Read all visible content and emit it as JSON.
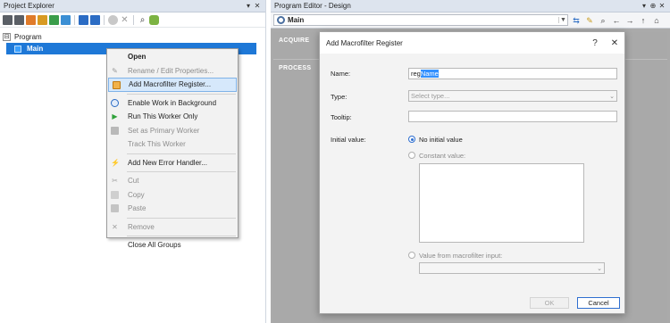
{
  "project_explorer": {
    "title": "Project Explorer",
    "pin": "▾",
    "close": "✕",
    "tree": {
      "root": {
        "expander": "⊟",
        "label": "Program"
      },
      "selected": {
        "label": "Main"
      }
    }
  },
  "context_menu": {
    "items": [
      {
        "label": "Open",
        "bold": true,
        "disabled": false,
        "icon": ""
      },
      {
        "label": "Rename / Edit Properties...",
        "disabled": true,
        "icon": "pencil-icon"
      },
      {
        "label": "Add Macrofilter Register...",
        "disabled": false,
        "icon": "register-icon",
        "hover": true
      },
      {
        "label": "Enable Work in Background",
        "disabled": false,
        "icon": "background-worker-icon"
      },
      {
        "label": "Run This Worker Only",
        "disabled": false,
        "icon": "play-icon"
      },
      {
        "label": "Set as Primary Worker",
        "disabled": true,
        "icon": "primary-worker-icon"
      },
      {
        "label": "Track This Worker",
        "disabled": true,
        "icon": ""
      },
      {
        "label": "Add New Error Handler...",
        "disabled": false,
        "icon": "error-handler-icon"
      },
      {
        "label": "Cut",
        "disabled": true,
        "icon": "scissors-icon"
      },
      {
        "label": "Copy",
        "disabled": true,
        "icon": "copy-icon"
      },
      {
        "label": "Paste",
        "disabled": true,
        "icon": "paste-icon"
      },
      {
        "label": "Remove",
        "disabled": true,
        "icon": "close-icon"
      },
      {
        "label": "Close All Groups",
        "disabled": false,
        "icon": ""
      }
    ]
  },
  "program_editor": {
    "title": "Program Editor - Design",
    "pin": "▾",
    "pin2": "⊕",
    "close": "✕",
    "macrofilter": "Main",
    "sections": [
      "ACQUIRE",
      "PROCESS"
    ]
  },
  "dialog": {
    "title": "Add Macrofilter Register",
    "help": "?",
    "close": "✕",
    "name_label": "Name:",
    "name_prefix": "reg",
    "name_selected": "Name",
    "type_label": "Type:",
    "type_placeholder": "Select type...",
    "tooltip_label": "Tooltip:",
    "initial_label": "Initial value:",
    "opt_none": "No initial value",
    "opt_constant": "Constant value:",
    "opt_input": "Value from macrofilter input:",
    "ok": "OK",
    "cancel": "Cancel"
  },
  "colors": {
    "selection": "#1e78d7",
    "menu_hover": "#d6e8fb",
    "editor_canvas": "#a9a9a9",
    "accent": "#2f6fd0"
  }
}
